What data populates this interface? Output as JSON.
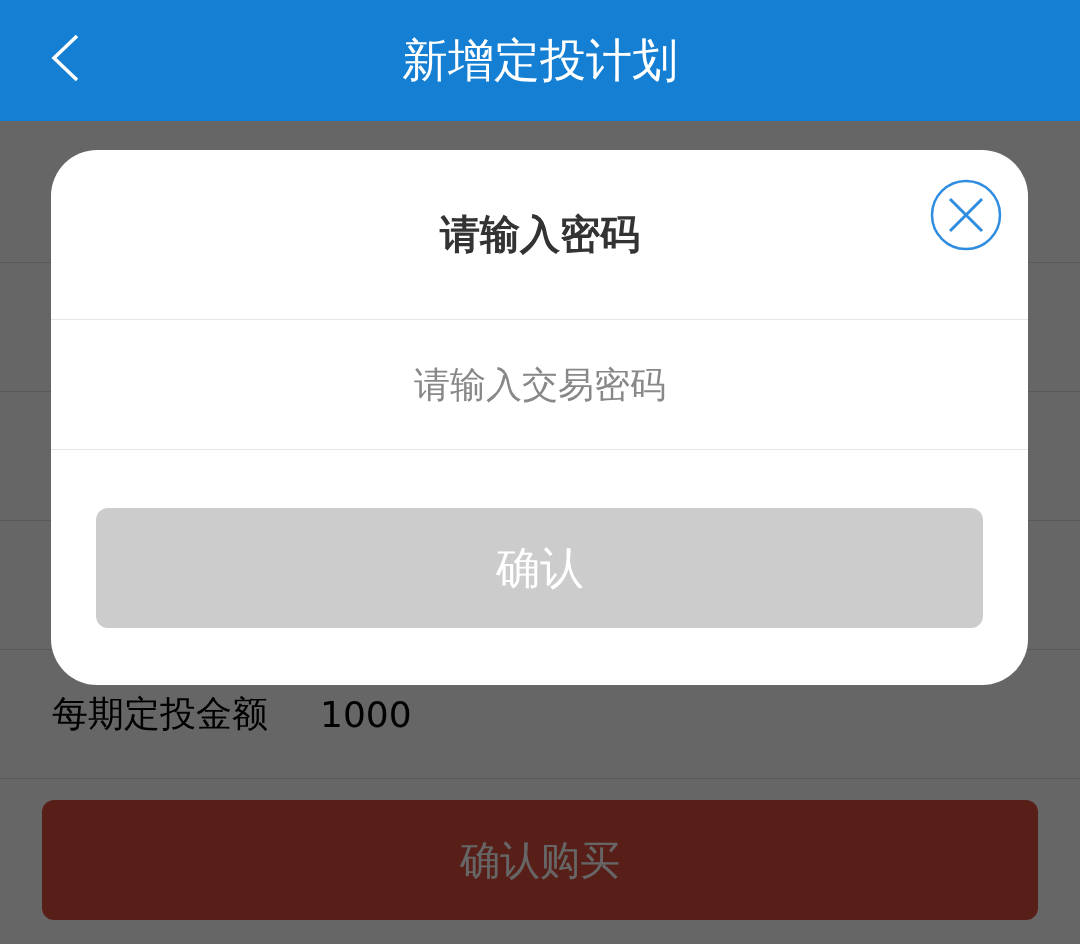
{
  "header": {
    "title": "新增定投计划"
  },
  "form_rows": [
    {
      "label": "每期定投金额",
      "value": "1000"
    }
  ],
  "submit_button": {
    "label": "确认购买",
    "disabled": false
  },
  "dialog": {
    "title": "请输入密码",
    "password_field": {
      "placeholder": "请输入交易密码"
    },
    "confirm_button": {
      "label": "确认",
      "disabled": true
    }
  }
}
